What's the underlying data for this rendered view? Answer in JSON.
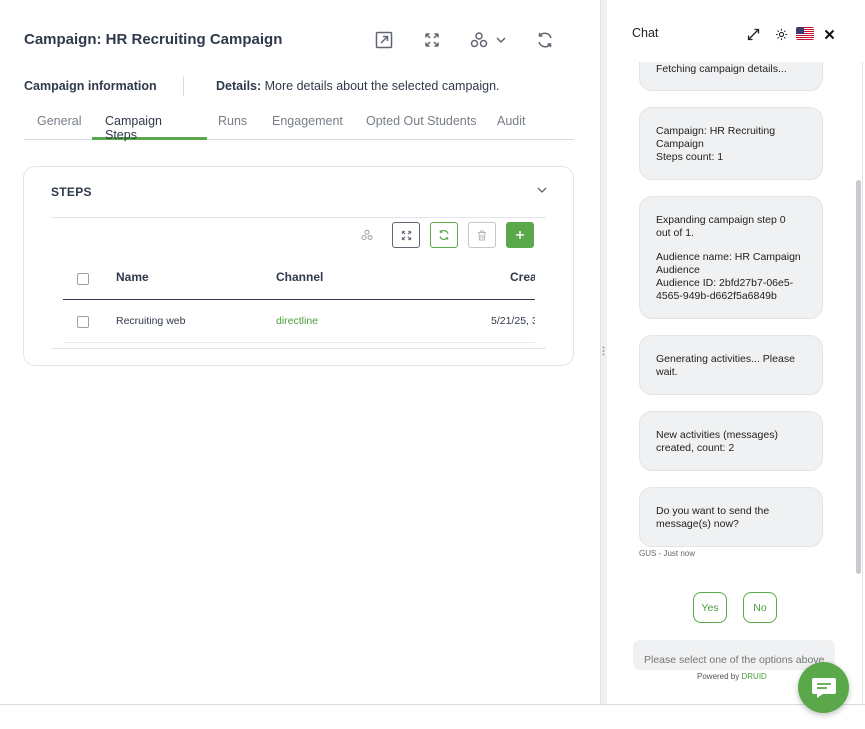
{
  "page": {
    "title": "Campaign: HR Recruiting Campaign",
    "info_title": "Campaign information",
    "details_label": "Details:",
    "details_text": "More details about the selected campaign."
  },
  "top_icons": [
    "open-external-icon",
    "expand-icon",
    "nodes-icon",
    "chevron-down-icon",
    "refresh-icon"
  ],
  "tabs": [
    {
      "label": "General",
      "active": false
    },
    {
      "label": "Campaign Steps",
      "active": true
    },
    {
      "label": "Runs",
      "active": false
    },
    {
      "label": "Engagement",
      "active": false
    },
    {
      "label": "Opted Out Students",
      "active": false
    },
    {
      "label": "Audit",
      "active": false
    }
  ],
  "steps": {
    "title": "STEPS",
    "toolbar": [
      "nodes-icon",
      "expand-icon",
      "refresh-icon",
      "trash-icon",
      "plus-icon"
    ],
    "columns": [
      "Name",
      "Channel",
      "Crea"
    ],
    "rows": [
      {
        "name": "Recruiting web",
        "channel": "directline",
        "created": "5/21/25, 3"
      }
    ]
  },
  "chat": {
    "title": "Chat",
    "messages": [
      [
        "Fetching campaign details..."
      ],
      [
        "Campaign: HR Recruiting",
        "Campaign",
        "Steps count: 1"
      ],
      [
        "Expanding campaign step 0",
        "out of 1.",
        "",
        "Audience name: HR Campaign",
        "Audience",
        "Audience ID: 2bfd27b7-06e5-",
        "4565-949b-d662f5a6849b"
      ],
      [
        "Generating activities... Please",
        "wait."
      ],
      [
        "New activities (messages)",
        "created, count: 2"
      ],
      [
        "Do you want to send the",
        "message(s) now?"
      ]
    ],
    "meta": "GUS - Just now",
    "choices": [
      "Yes",
      "No"
    ],
    "input_placeholder": "Please select one of the options above",
    "powered_by": "Powered by",
    "brand": "DRUID"
  },
  "colors": {
    "accent": "#5aa84a",
    "text_dark": "#2f3a4a",
    "bubble": "#f0f1f2"
  }
}
